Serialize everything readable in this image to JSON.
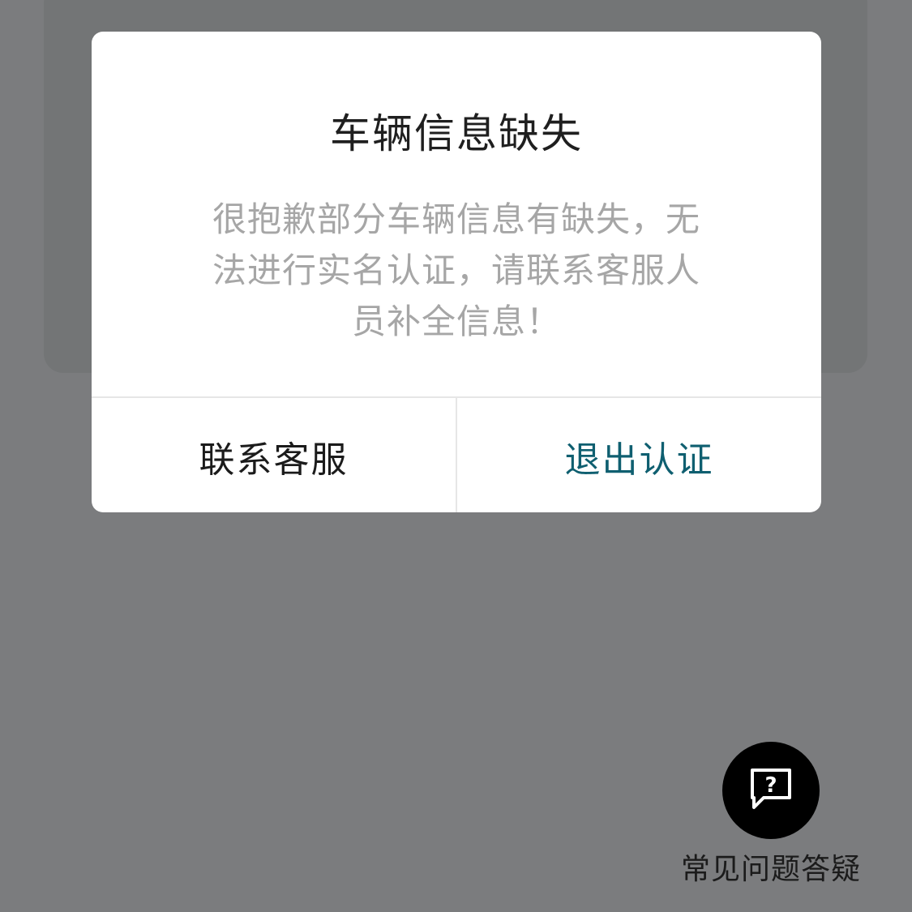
{
  "dialog": {
    "title": "车辆信息缺失",
    "message_lines": [
      "很抱歉部分车辆信息有缺失，无",
      "法进行实名认证，请联系客服人",
      "员补全信息！"
    ],
    "contact_label": "联系客服",
    "exit_label": "退出认证"
  },
  "faq": {
    "label": "常见问题答疑",
    "icon": "question-chat-icon"
  },
  "colors": {
    "overlay_bg": "#7b7c7e",
    "dialog_bg": "#ffffff",
    "title_text": "#1f1f1f",
    "message_text": "#a6a6a6",
    "accent": "#0f5f70",
    "faq_button_bg": "#000000"
  }
}
